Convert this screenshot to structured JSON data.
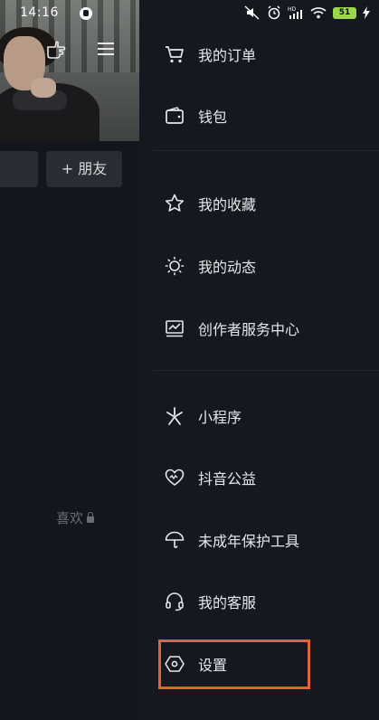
{
  "status_bar": {
    "time": "14:16",
    "battery": "51"
  },
  "profile": {
    "add_friend": "+ 朋友",
    "likes_label": "喜欢"
  },
  "drawer": {
    "items": [
      {
        "label": "我的订单",
        "icon": "cart-icon"
      },
      {
        "label": "钱包",
        "icon": "wallet-icon"
      },
      {
        "label": "我的收藏",
        "icon": "star-icon"
      },
      {
        "label": "我的动态",
        "icon": "sun-icon"
      },
      {
        "label": "创作者服务中心",
        "icon": "chart-icon"
      },
      {
        "label": "小程序",
        "icon": "asterisk-icon"
      },
      {
        "label": "抖音公益",
        "icon": "heart-icon"
      },
      {
        "label": "未成年保护工具",
        "icon": "umbrella-icon"
      },
      {
        "label": "我的客服",
        "icon": "headset-icon"
      },
      {
        "label": "设置",
        "icon": "settings-hexagon-icon"
      }
    ]
  },
  "colors": {
    "highlight": "#e0643a",
    "background": "#16181f"
  }
}
